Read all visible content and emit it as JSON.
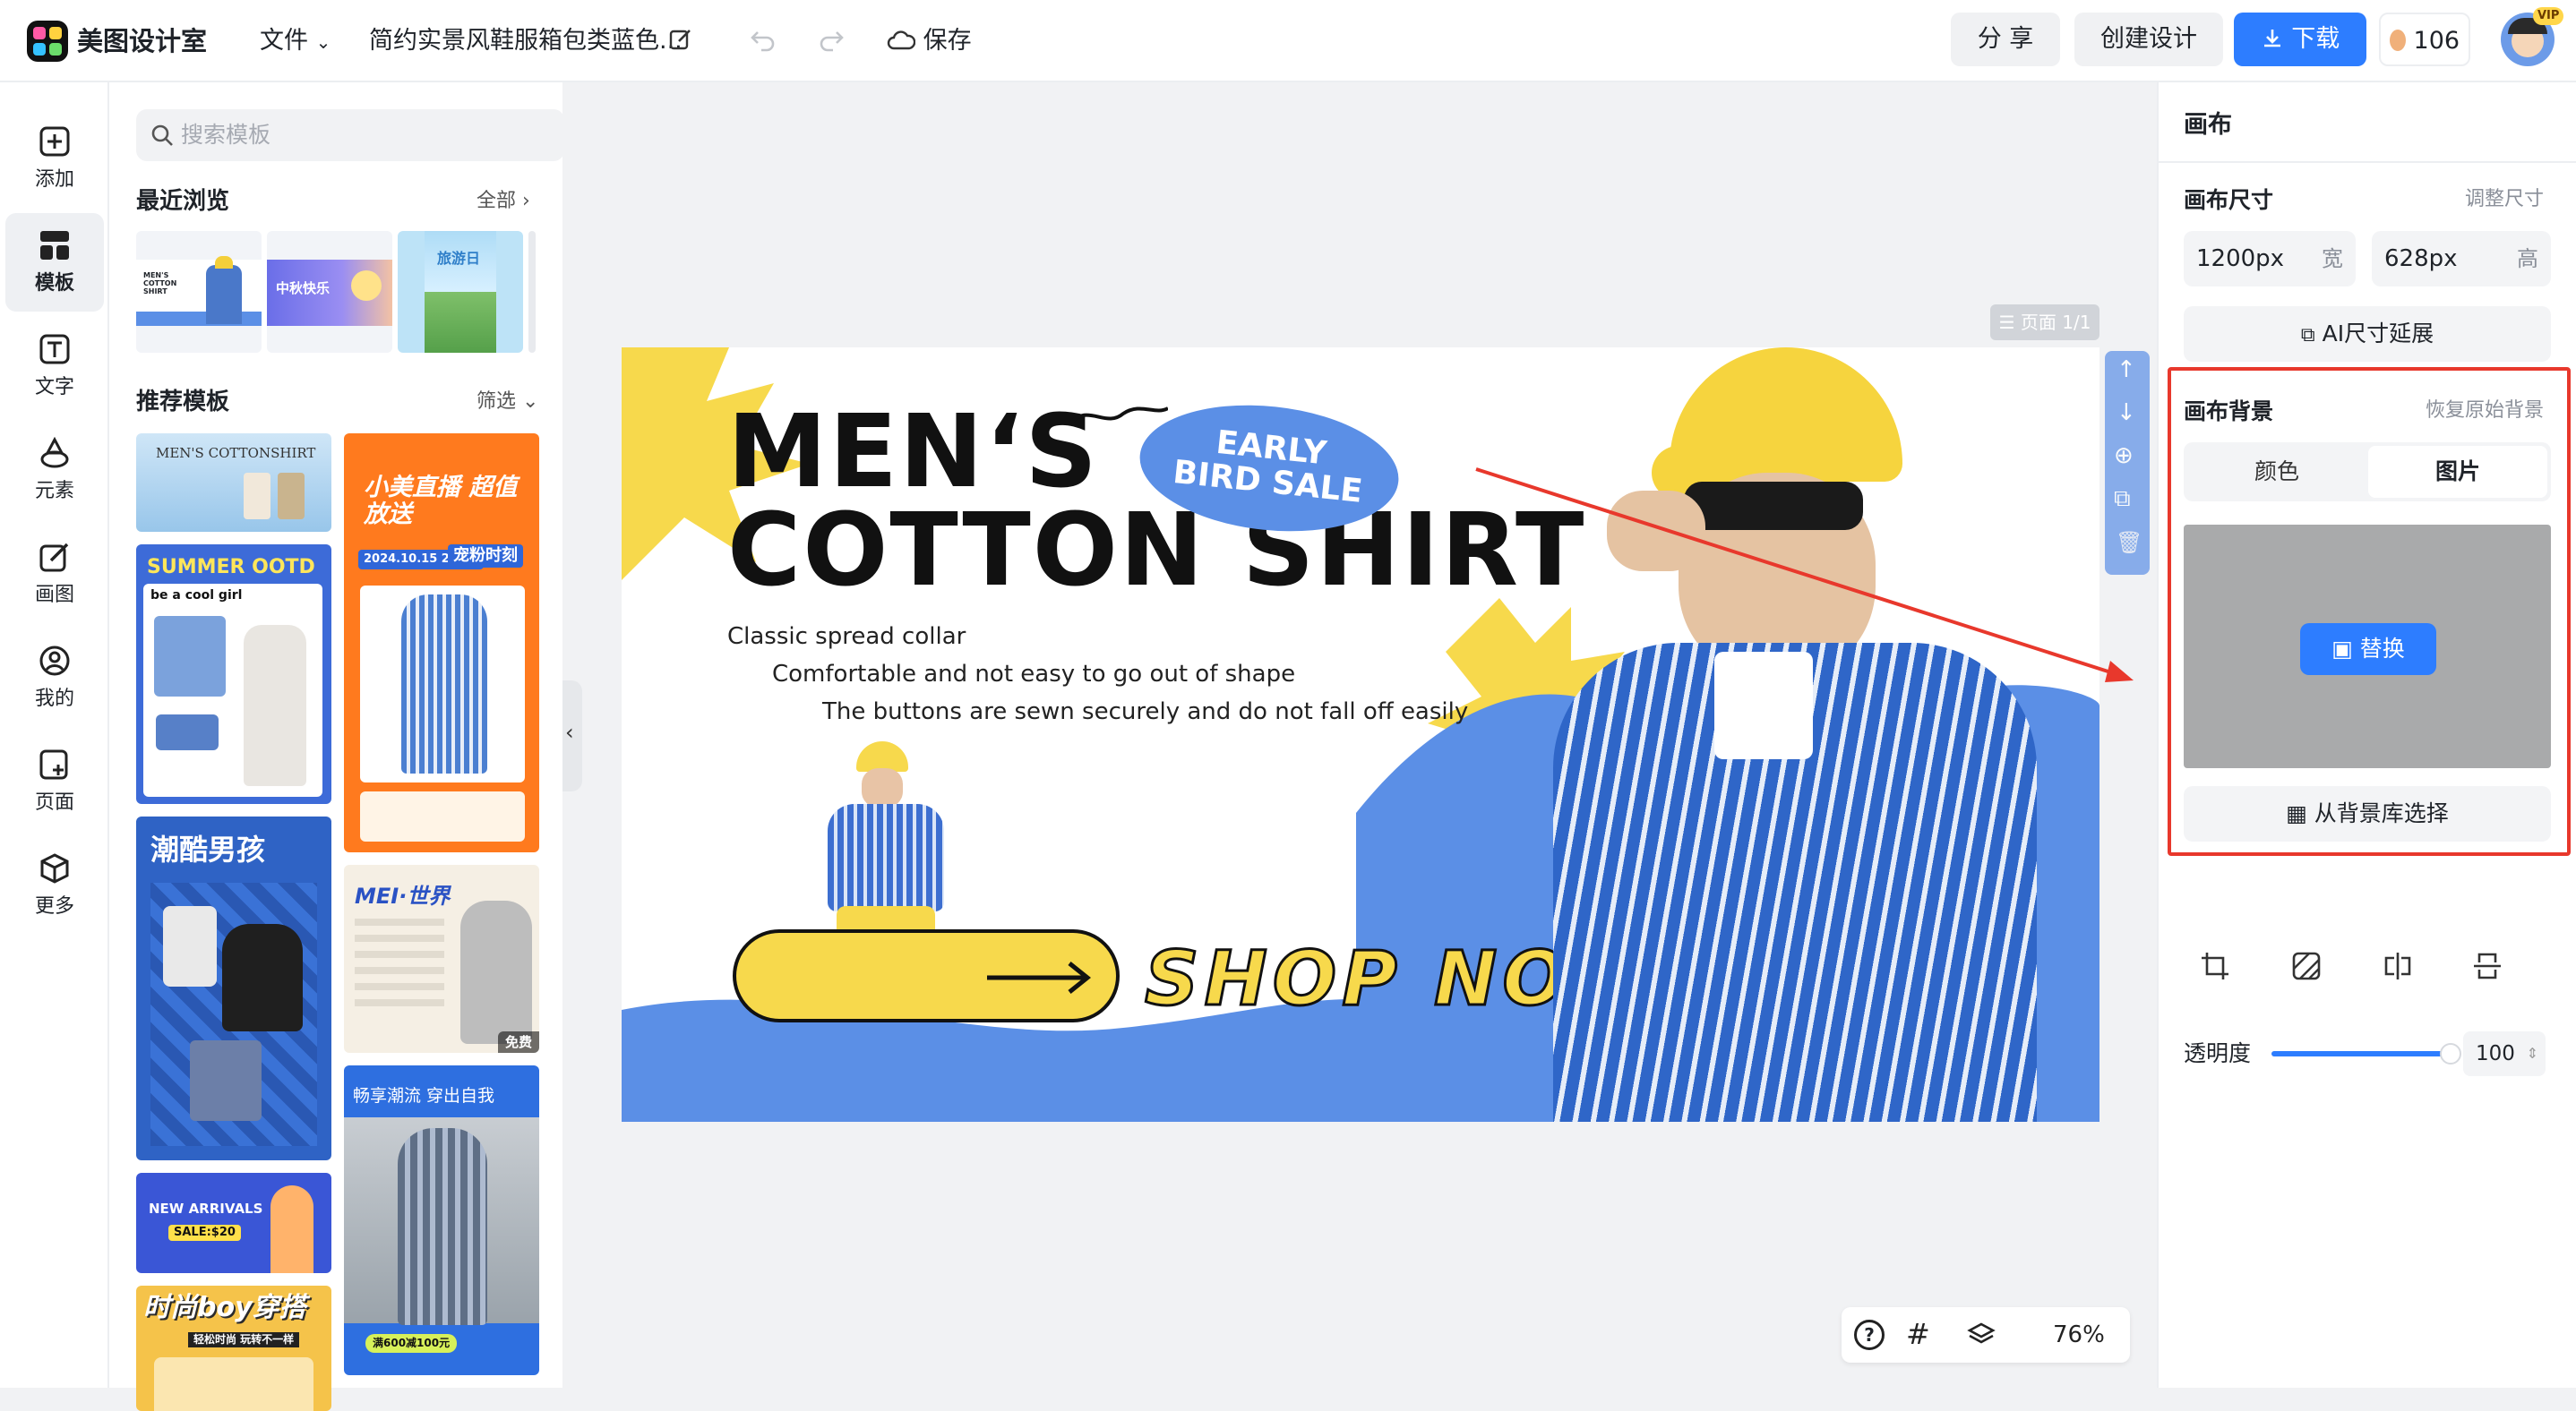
{
  "app": {
    "name": "美图设计室",
    "menu_file": "文件",
    "doc_title": "简约实景风鞋服箱包类蓝色...",
    "save_label": "保存",
    "share_label": "分 享",
    "create_label": "创建设计",
    "download_label": "下载",
    "credits": "106",
    "vip_badge": "VIP"
  },
  "leftnav": {
    "items": [
      {
        "label": "添加",
        "icon": "plus-square-icon"
      },
      {
        "label": "模板",
        "icon": "template-grid-icon"
      },
      {
        "label": "文字",
        "icon": "text-icon"
      },
      {
        "label": "元素",
        "icon": "shapes-icon"
      },
      {
        "label": "画图",
        "icon": "pen-edit-icon"
      },
      {
        "label": "我的",
        "icon": "user-icon"
      },
      {
        "label": "页面",
        "icon": "page-add-icon"
      },
      {
        "label": "更多",
        "icon": "cube-icon"
      }
    ],
    "active_index": 1
  },
  "templates": {
    "search_placeholder": "搜索模板",
    "recent_title": "最近浏览",
    "recent_more": "全部",
    "recent_thumbs": [
      "MEN'S COTTON SHIRT",
      "中秋快乐",
      "旅游日"
    ],
    "recommend_title": "推荐模板",
    "recommend_filter": "筛选",
    "cards": {
      "c1": "MEN'S COTTONSHIRT",
      "c2": "小美直播 超值放送",
      "c2_time": "2024.10.15 20:00",
      "c2_sub": "宠粉时刻",
      "c3": "SUMMER OOTD",
      "c3_sub": "be a cool girl",
      "c4": "潮酷男孩",
      "c5": "MEI·世界",
      "c5_badge": "免费",
      "c6": "畅享潮流 穿出自我",
      "c6_foot": "满600减100元",
      "c7": "NEW ARRIVALS",
      "c7_sale": "SALE:$20",
      "c8": "时尚boy穿搭",
      "c8_sub": "轻松时尚 玩转不一样"
    }
  },
  "canvas": {
    "page_indicator": "页面 1/1",
    "headline_1": "MEN‘S",
    "headline_2": "COTTON SHIRT",
    "badge_line1": "EARLY",
    "badge_line2": "BIRD SALE",
    "bullet_1": "Classic spread collar",
    "bullet_2": "Comfortable and not easy to go out of shape",
    "bullet_3": "The buttons are sewn securely and do not fall off easily",
    "cta": "SHOP NOW",
    "zoom": "76%",
    "colors": {
      "blue": "#5b8fe6",
      "yellow": "#f7d94c",
      "accent": "#2d7dff",
      "highlight": "#e8382c"
    }
  },
  "rightpanel": {
    "title": "画布",
    "size_title": "画布尺寸",
    "size_adjust": "调整尺寸",
    "width_value": "1200px",
    "width_unit": "宽",
    "height_value": "628px",
    "height_unit": "高",
    "ai_extend": "AI尺寸延展",
    "bg_title": "画布背景",
    "bg_restore": "恢复原始背景",
    "tab_color": "颜色",
    "tab_image": "图片",
    "replace": "替换",
    "from_library": "从背景库选择",
    "opacity_label": "透明度",
    "opacity_value": "100",
    "opacity_fraction": 1.0
  }
}
